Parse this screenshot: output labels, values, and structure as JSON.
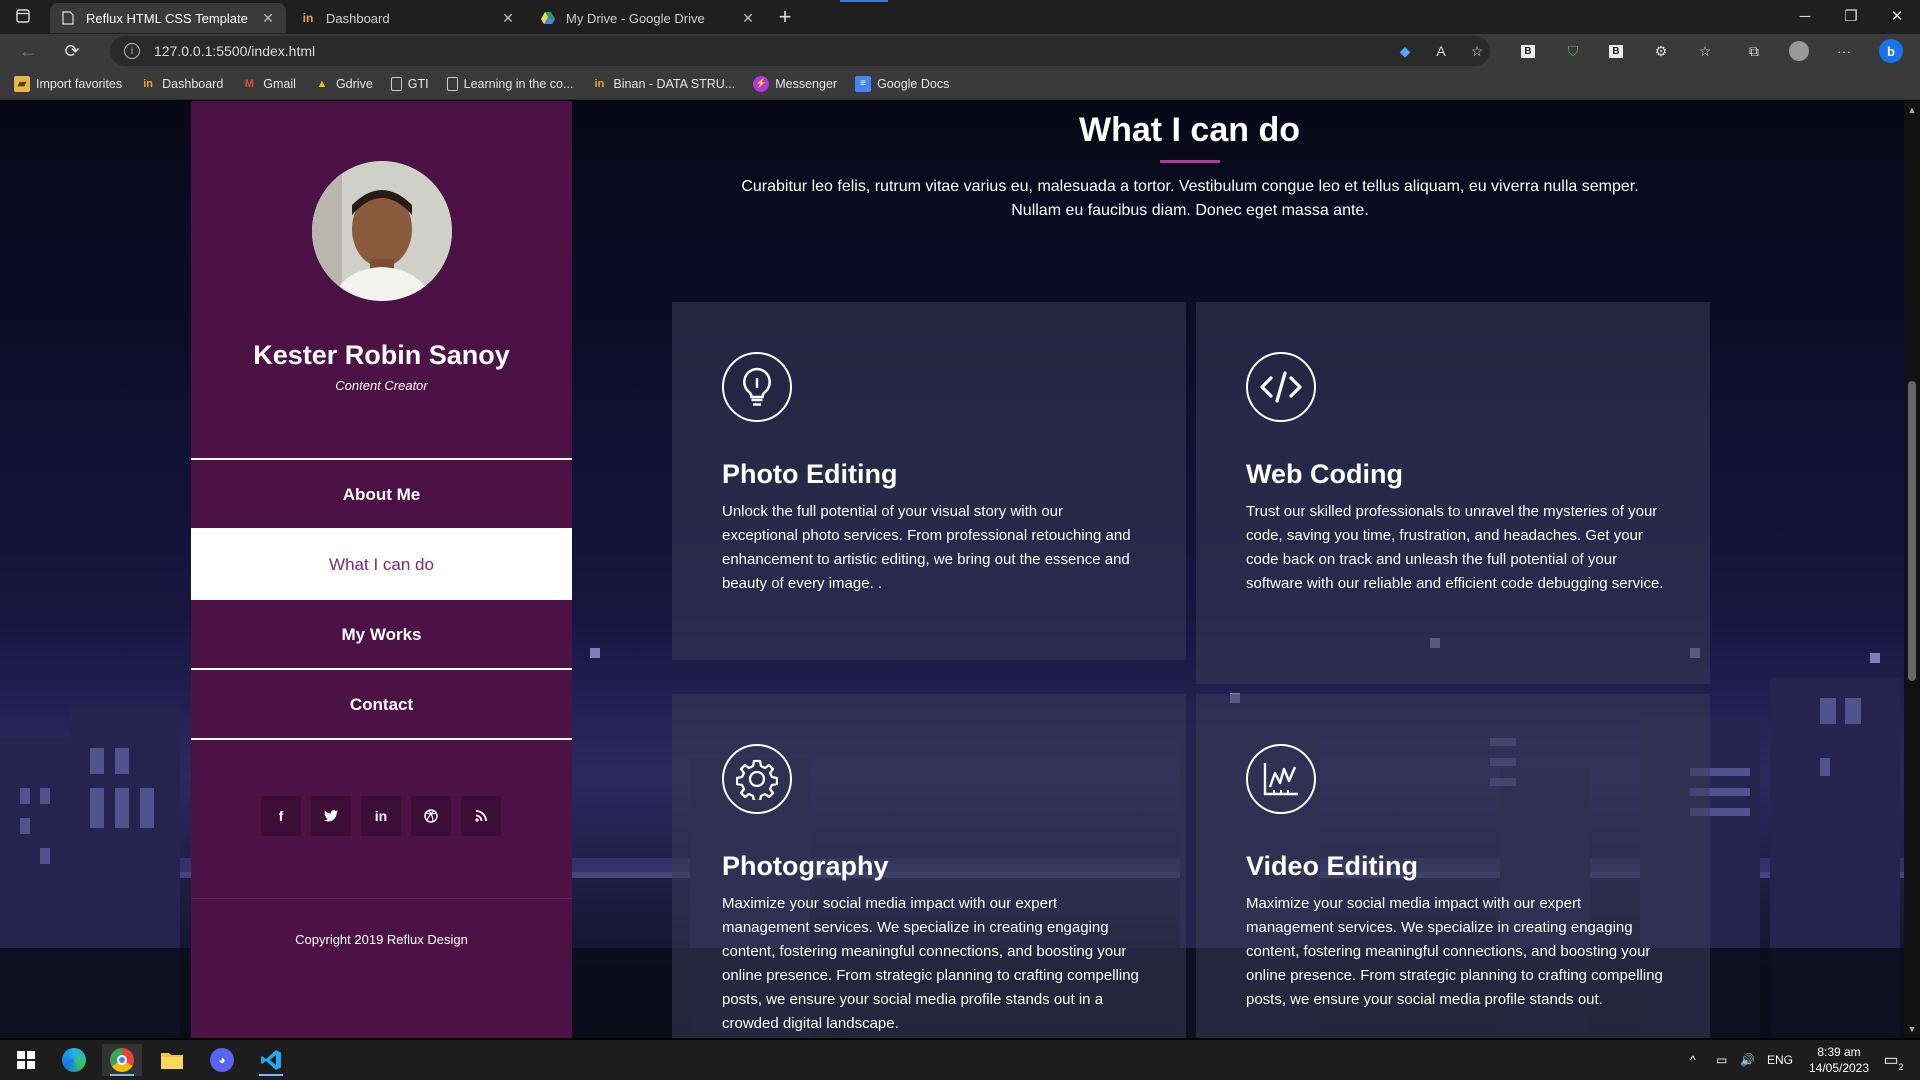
{
  "browser": {
    "tabs": [
      {
        "title": "Reflux HTML CSS Template",
        "active": true
      },
      {
        "title": "Dashboard",
        "active": false
      },
      {
        "title": "My Drive - Google Drive",
        "active": false
      }
    ],
    "url": "127.0.0.1:5500/index.html",
    "bookmarks": [
      {
        "label": "Import favorites",
        "icon": "folder-icon"
      },
      {
        "label": "Dashboard",
        "icon": "dashboard-logo-icon"
      },
      {
        "label": "Gmail",
        "icon": "gmail-icon"
      },
      {
        "label": "Gdrive",
        "icon": "gdrive-icon"
      },
      {
        "label": "GTI",
        "icon": "page-icon"
      },
      {
        "label": "Learning in the co...",
        "icon": "page-icon"
      },
      {
        "label": "Binan - DATA STRU...",
        "icon": "dashboard-logo-icon"
      },
      {
        "label": "Messenger",
        "icon": "messenger-icon"
      },
      {
        "label": "Google Docs",
        "icon": "docs-icon"
      }
    ]
  },
  "sidebar": {
    "name": "Kester Robin Sanoy",
    "role": "Content Creator",
    "menu": [
      {
        "label": "About Me",
        "active": false
      },
      {
        "label": "What I can do",
        "active": true
      },
      {
        "label": "My Works",
        "active": false
      },
      {
        "label": "Contact",
        "active": false
      }
    ],
    "socials": [
      "facebook-icon",
      "twitter-icon",
      "linkedin-icon",
      "dribbble-icon",
      "rss-icon"
    ],
    "copyright": "Copyright 2019 Reflux Design"
  },
  "section": {
    "title": "What I can do",
    "description": "Curabitur leo felis, rutrum vitae varius eu, malesuada a tortor. Vestibulum congue leo et tellus aliquam, eu viverra nulla semper. Nullam eu faucibus diam. Donec eget massa ante."
  },
  "cards": [
    {
      "icon": "lightbulb-icon",
      "title": "Photo Editing",
      "text": "Unlock the full potential of your visual story with our exceptional photo services. From professional retouching and enhancement to artistic editing, we bring out the essence and beauty of every image. ."
    },
    {
      "icon": "code-icon",
      "title": "Web Coding",
      "text": "Trust our skilled professionals to unravel the mysteries of your code, saving you time, frustration, and headaches. Get your code back on track and unleash the full potential of your software with our reliable and efficient code debugging service."
    },
    {
      "icon": "gear-icon",
      "title": "Photography",
      "text": "Maximize your social media impact with our expert management services. We specialize in creating engaging content, fostering meaningful connections, and boosting your online presence. From strategic planning to crafting compelling posts, we ensure your social media profile stands out in a crowded digital landscape."
    },
    {
      "icon": "chart-icon",
      "title": "Video Editing",
      "text": "Maximize your social media impact with our expert management services. We specialize in creating engaging content, fostering meaningful connections, and boosting your online presence. From strategic planning to crafting compelling posts, we ensure your social media profile stands out."
    }
  ],
  "taskbar": {
    "language": "ENG",
    "time": "8:39 am",
    "date": "14/05/2023",
    "notifications": "2"
  },
  "colors": {
    "sidebar_bg": "#4c1246",
    "accent": "#b0369e",
    "active_menu_text": "#7a2a78"
  }
}
